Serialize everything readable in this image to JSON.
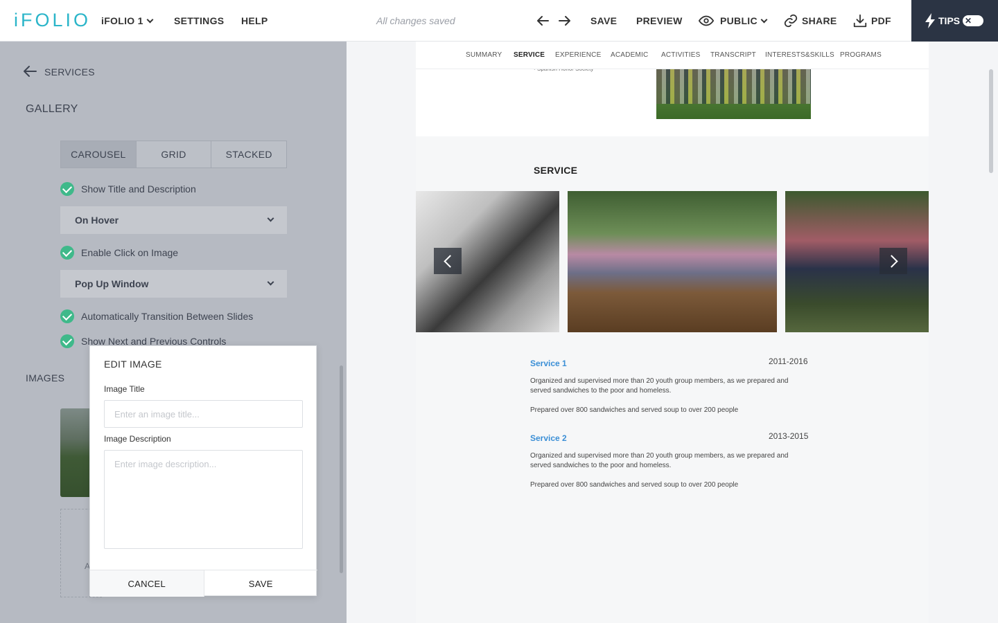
{
  "topbar": {
    "logo": "iFOLIO",
    "folio_menu": "iFOLIO 1",
    "settings": "SETTINGS",
    "help": "HELP",
    "status": "All changes saved",
    "save": "SAVE",
    "preview": "PREVIEW",
    "visibility": "PUBLIC",
    "share": "SHARE",
    "pdf": "PDF",
    "tips": "TIPS"
  },
  "leftpanel": {
    "back_label": "SERVICES",
    "gallery_title": "GALLERY",
    "layout_options": [
      "CAROUSEL",
      "GRID",
      "STACKED"
    ],
    "active_layout": "CAROUSEL",
    "show_title_desc": "Show Title and Description",
    "title_desc_mode": "On Hover",
    "enable_click": "Enable Click on Image",
    "click_mode": "Pop Up Window",
    "auto_transition": "Automatically Transition Between Slides",
    "show_controls": "Show Next and Previous Controls",
    "images_title": "IMAGES",
    "add_label": "A"
  },
  "modal": {
    "title": "EDIT IMAGE",
    "image_title_label": "Image Title",
    "image_title_placeholder": "Enter an image title...",
    "image_desc_label": "Image Description",
    "image_desc_placeholder": "Enter image description...",
    "cancel": "CANCEL",
    "save": "SAVE"
  },
  "preview": {
    "tabs": [
      "SUMMARY",
      "SERVICE",
      "EXPERIENCE",
      "ACADEMIC",
      "ACTIVITIES",
      "TRANSCRIPT",
      "INTERESTS&SKILLS",
      "PROGRAMS"
    ],
    "active_tab": "SERVICE",
    "snippet": "• Spanish Honor Society",
    "section_heading": "SERVICE",
    "entries": [
      {
        "title": "Service 1",
        "date": "2011-2016",
        "desc": "Organized and supervised more than 20 youth group members, as we prepared and served sandwiches to the poor and homeless.",
        "note": "Prepared over 800 sandwiches and served soup to over 200 people"
      },
      {
        "title": "Service 2",
        "date": "2013-2015",
        "desc": "Organized and supervised more than 20 youth group members, as we prepared and served sandwiches to the poor and homeless.",
        "note": "Prepared over 800 sandwiches and served soup to over 200 people"
      }
    ]
  },
  "colors": {
    "accent": "#2bb5c9",
    "check": "#3fb98a",
    "link": "#3b8fd6",
    "tips_bg": "#2b3444"
  }
}
